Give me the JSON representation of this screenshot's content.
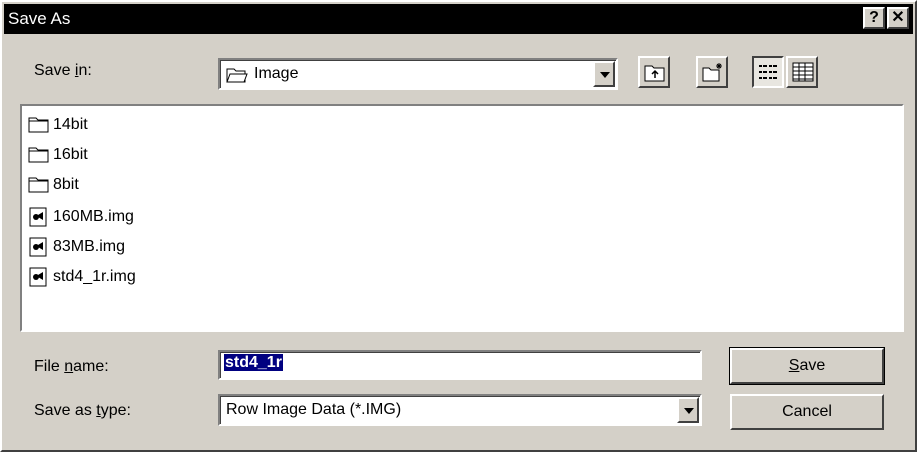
{
  "window": {
    "title": "Save As",
    "help_button": "?",
    "close_button": "✕"
  },
  "save_in": {
    "label_pre": "Save ",
    "label_accel": "i",
    "label_post": "n:",
    "value": "Image",
    "tools": [
      "up-one-level-icon",
      "create-new-folder-icon",
      "list-view-icon",
      "details-view-icon"
    ]
  },
  "files": [
    {
      "name": "14bit",
      "type": "folder"
    },
    {
      "name": "16bit",
      "type": "folder"
    },
    {
      "name": "8bit",
      "type": "folder"
    },
    {
      "name": "160MB.img",
      "type": "file"
    },
    {
      "name": "83MB.img",
      "type": "file"
    },
    {
      "name": "std4_1r.img",
      "type": "file"
    }
  ],
  "file_name": {
    "label_pre": "File ",
    "label_accel": "n",
    "label_post": "ame:",
    "value": "std4_1r"
  },
  "save_as_type": {
    "label_pre": "Save as ",
    "label_accel": "t",
    "label_post": "ype:",
    "value": "Row Image Data (*.IMG)"
  },
  "buttons": {
    "save_accel": "S",
    "save_rest": "ave",
    "cancel": "Cancel"
  }
}
